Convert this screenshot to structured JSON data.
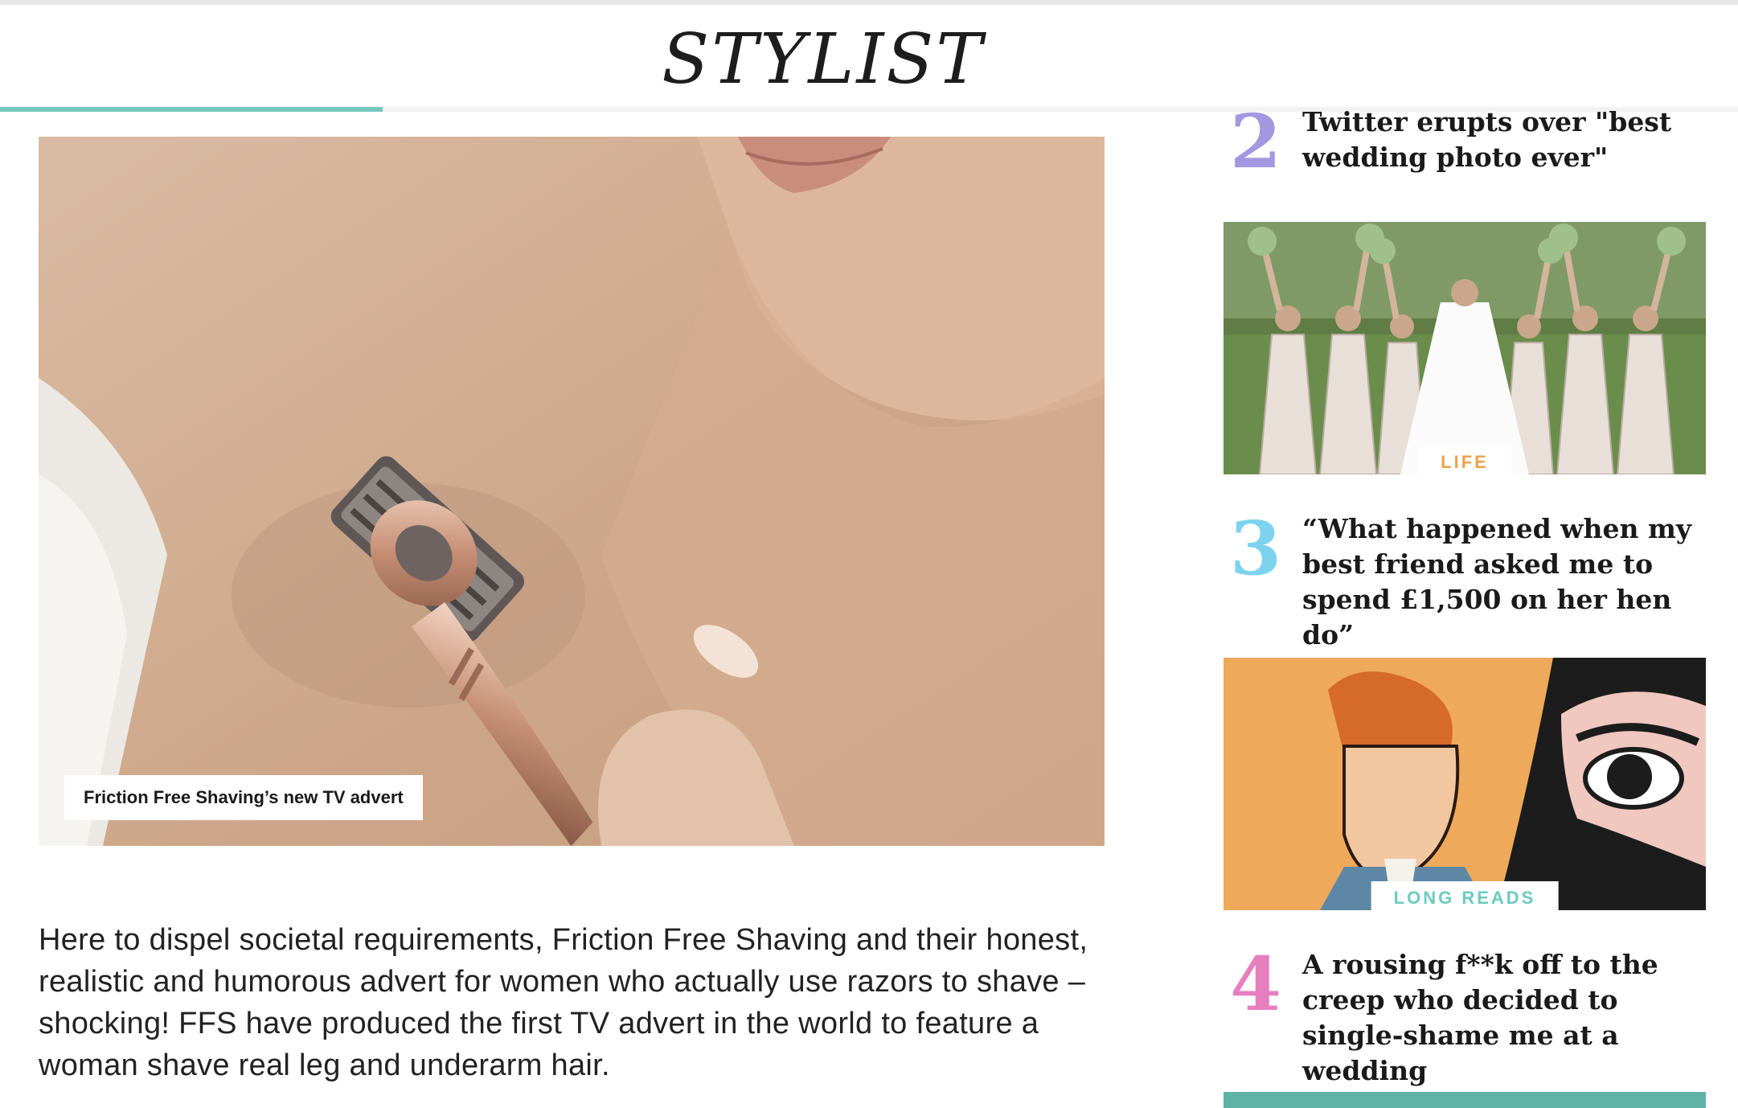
{
  "header": {
    "logo": "STYLIST",
    "reading_progress": 0.22
  },
  "article": {
    "hero_caption": "Friction Free Shaving’s new TV advert",
    "paragraph": "Here to dispel societal requirements, Friction Free Shaving and their honest, realistic and humorous advert for women who actually use razors to shave – shocking! FFS have produced the first TV advert in the world to feature a woman shave real leg and underarm hair."
  },
  "sidebar": {
    "items": [
      {
        "number": "2",
        "color": "#a398e0",
        "title": "Twitter erupts over \"best wedding photo ever\""
      },
      {
        "tag": "LIFE",
        "tag_color": "#f0a04b"
      },
      {
        "number": "3",
        "color": "#7dd3ee",
        "title": "“What happened when my best friend asked me to spend £1,500 on her hen do”"
      },
      {
        "tag": "LONG READS",
        "tag_color": "#6ccbbf"
      },
      {
        "number": "4",
        "color": "#e77fbf",
        "title": "A rousing f**k off to the creep who decided to single-shame me at a wedding"
      }
    ]
  }
}
